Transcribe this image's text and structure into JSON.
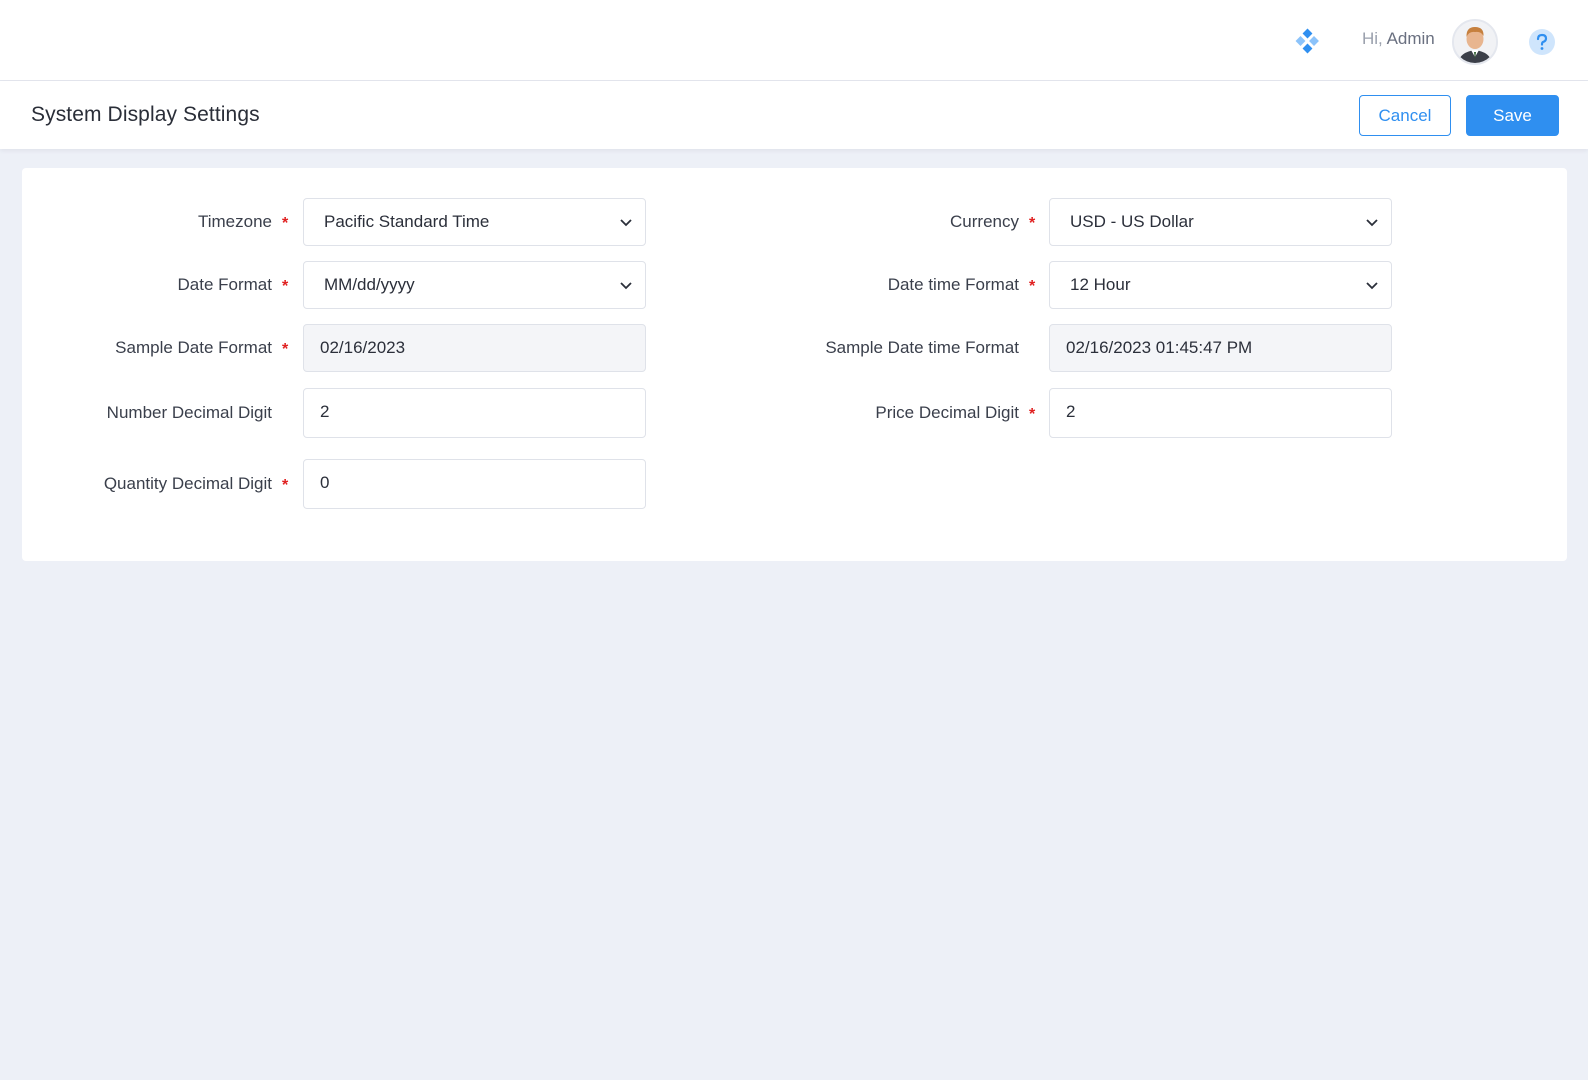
{
  "topbar": {
    "greeting_prefix": "Hi,",
    "user_name": "Admin",
    "apps_icon": "apps-diamond-icon",
    "help_icon": "question-circle-icon"
  },
  "header": {
    "title": "System Display Settings",
    "cancel_label": "Cancel",
    "save_label": "Save"
  },
  "form": {
    "timezone": {
      "label": "Timezone",
      "value": "Pacific Standard Time",
      "required": true
    },
    "date_format": {
      "label": "Date Format",
      "value": "MM/dd/yyyy",
      "required": true
    },
    "sample_date_format": {
      "label": "Sample Date Format",
      "value": "02/16/2023",
      "required": true
    },
    "number_decimal_digit": {
      "label": "Number Decimal Digit",
      "value": "2",
      "required": false
    },
    "quantity_decimal_digit": {
      "label": "Quantity Decimal Digit",
      "value": "0",
      "required": true
    },
    "currency": {
      "label": "Currency",
      "value": "USD - US Dollar",
      "required": true
    },
    "date_time_format": {
      "label": "Date time Format",
      "value": "12 Hour",
      "required": true
    },
    "sample_date_time_format": {
      "label": "Sample Date time Format",
      "value": "02/16/2023 01:45:47 PM",
      "required": false
    },
    "price_decimal_digit": {
      "label": "Price Decimal Digit",
      "value": "2",
      "required": true
    }
  },
  "colors": {
    "accent": "#2f8ff0",
    "required": "#e02020",
    "background": "#edf0f7"
  }
}
